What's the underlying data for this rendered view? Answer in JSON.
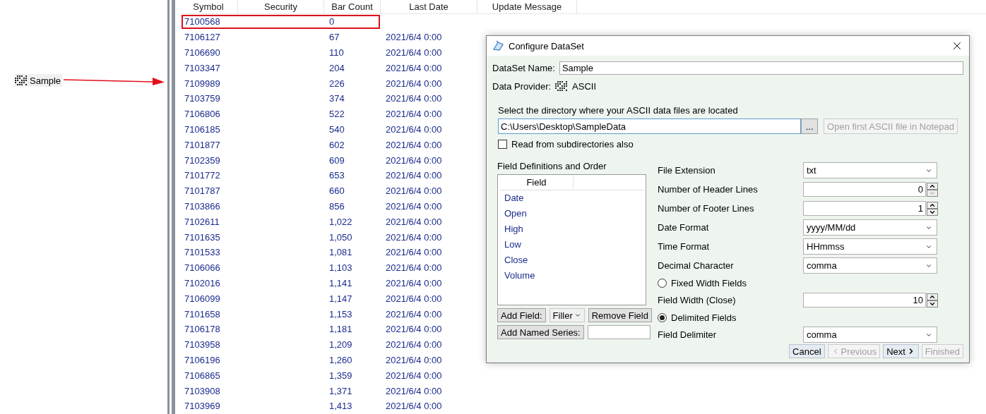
{
  "sidebar": {
    "items": [
      {
        "label": "Sample",
        "selected": true
      }
    ]
  },
  "table": {
    "columns": [
      "Symbol",
      "Security",
      "Bar Count",
      "Last Date",
      "Update Message"
    ],
    "rows": [
      {
        "symbol": "7100568",
        "bar_count": "0",
        "highlighted": true
      },
      {
        "symbol": "7106127",
        "bar_count": "67",
        "last_date": "2021/6/4 0:00",
        "highlighted": false
      },
      {
        "symbol": "7106690",
        "bar_count": "110",
        "last_date": "2021/6/4 0:00",
        "highlighted": false
      },
      {
        "symbol": "7103347",
        "bar_count": "204",
        "last_date": "2021/6/4 0:00",
        "highlighted": false
      },
      {
        "symbol": "7109989",
        "bar_count": "226",
        "last_date": "2021/6/4 0:00",
        "highlighted": false
      },
      {
        "symbol": "7103759",
        "bar_count": "374",
        "last_date": "2021/6/4 0:00",
        "highlighted": false
      },
      {
        "symbol": "7106806",
        "bar_count": "522",
        "last_date": "2021/6/4 0:00",
        "highlighted": false
      },
      {
        "symbol": "7106185",
        "bar_count": "540",
        "last_date": "2021/6/4 0:00",
        "highlighted": false
      },
      {
        "symbol": "7101877",
        "bar_count": "602",
        "last_date": "2021/6/4 0:00",
        "highlighted": false
      },
      {
        "symbol": "7102359",
        "bar_count": "609",
        "last_date": "2021/6/4 0:00",
        "highlighted": false
      },
      {
        "symbol": "7101772",
        "bar_count": "653",
        "last_date": "2021/6/4 0:00",
        "highlighted": false
      },
      {
        "symbol": "7101787",
        "bar_count": "660",
        "last_date": "2021/6/4 0:00",
        "highlighted": false
      },
      {
        "symbol": "7103866",
        "bar_count": "856",
        "last_date": "2021/6/4 0:00",
        "highlighted": false
      },
      {
        "symbol": "7102611",
        "bar_count": "1,022",
        "last_date": "2021/6/4 0:00",
        "highlighted": false
      },
      {
        "symbol": "7101635",
        "bar_count": "1,050",
        "last_date": "2021/6/4 0:00",
        "highlighted": false
      },
      {
        "symbol": "7101533",
        "bar_count": "1,081",
        "last_date": "2021/6/4 0:00",
        "highlighted": false
      },
      {
        "symbol": "7106066",
        "bar_count": "1,103",
        "last_date": "2021/6/4 0:00",
        "highlighted": false
      },
      {
        "symbol": "7102016",
        "bar_count": "1,141",
        "last_date": "2021/6/4 0:00",
        "highlighted": false
      },
      {
        "symbol": "7106099",
        "bar_count": "1,147",
        "last_date": "2021/6/4 0:00",
        "highlighted": false
      },
      {
        "symbol": "7101658",
        "bar_count": "1,153",
        "last_date": "2021/6/4 0:00",
        "highlighted": false
      },
      {
        "symbol": "7106178",
        "bar_count": "1,181",
        "last_date": "2021/6/4 0:00",
        "highlighted": false
      },
      {
        "symbol": "7103958",
        "bar_count": "1,209",
        "last_date": "2021/6/4 0:00",
        "highlighted": false
      },
      {
        "symbol": "7106196",
        "bar_count": "1,260",
        "last_date": "2021/6/4 0:00",
        "highlighted": false
      },
      {
        "symbol": "7106865",
        "bar_count": "1,359",
        "last_date": "2021/6/4 0:00",
        "highlighted": false
      },
      {
        "symbol": "7103908",
        "bar_count": "1,371",
        "last_date": "2021/6/4 0:00",
        "highlighted": false
      },
      {
        "symbol": "7103969",
        "bar_count": "1,413",
        "last_date": "2021/6/4 0:00",
        "highlighted": false
      }
    ]
  },
  "dialog": {
    "title": "Configure DataSet",
    "name_label": "DataSet Name:",
    "name_value": "Sample",
    "provider_label": "Data Provider:",
    "provider_value": "ASCII",
    "directory_prompt": "Select the directory where your ASCII data files are located",
    "directory_value": "C:\\Users\\Desktop\\SampleData",
    "browse_button": "...",
    "notepad_button": {
      "label": "Open first ASCII file in Notepad",
      "disabled": true
    },
    "subdirectories": {
      "label": "Read from subdirectories also",
      "checked": false
    },
    "fields_title": "Field Definitions and Order",
    "fields_column": "Field",
    "fields": [
      "Date",
      "Open",
      "High",
      "Low",
      "Close",
      "Volume"
    ],
    "add_field_button": "Add Field:",
    "field_type": "Filler",
    "remove_field_button": "Remove Field",
    "add_series_button": "Add Named Series:",
    "settings": [
      {
        "kind": "combo",
        "label": "File Extension",
        "value": "txt"
      },
      {
        "kind": "spin",
        "label": "Number of Header Lines",
        "value": "0",
        "down_disabled": true
      },
      {
        "kind": "spin",
        "label": "Number of Footer Lines",
        "value": "1",
        "down_disabled": false
      },
      {
        "kind": "combo",
        "label": "Date Format",
        "value": "yyyy/MM/dd"
      },
      {
        "kind": "combo",
        "label": "Time Format",
        "value": "HHmmss"
      },
      {
        "kind": "combo",
        "label": "Decimal Character",
        "value": "comma"
      },
      {
        "kind": "radio",
        "label": "Fixed Width Fields",
        "selected": false
      },
      {
        "kind": "spin",
        "label": "Field Width (Close)",
        "value": "10",
        "down_disabled": false
      },
      {
        "kind": "radio",
        "label": "Delimited Fields",
        "selected": true
      },
      {
        "kind": "combo",
        "label": "Field Delimiter",
        "value": "comma"
      }
    ],
    "buttons": [
      {
        "label": "Cancel",
        "kind": "plain",
        "disabled": false
      },
      {
        "label": "Previous",
        "kind": "back",
        "disabled": true
      },
      {
        "label": "Next",
        "kind": "forward",
        "disabled": false
      },
      {
        "label": "Finished",
        "kind": "plain",
        "disabled": true
      }
    ]
  }
}
